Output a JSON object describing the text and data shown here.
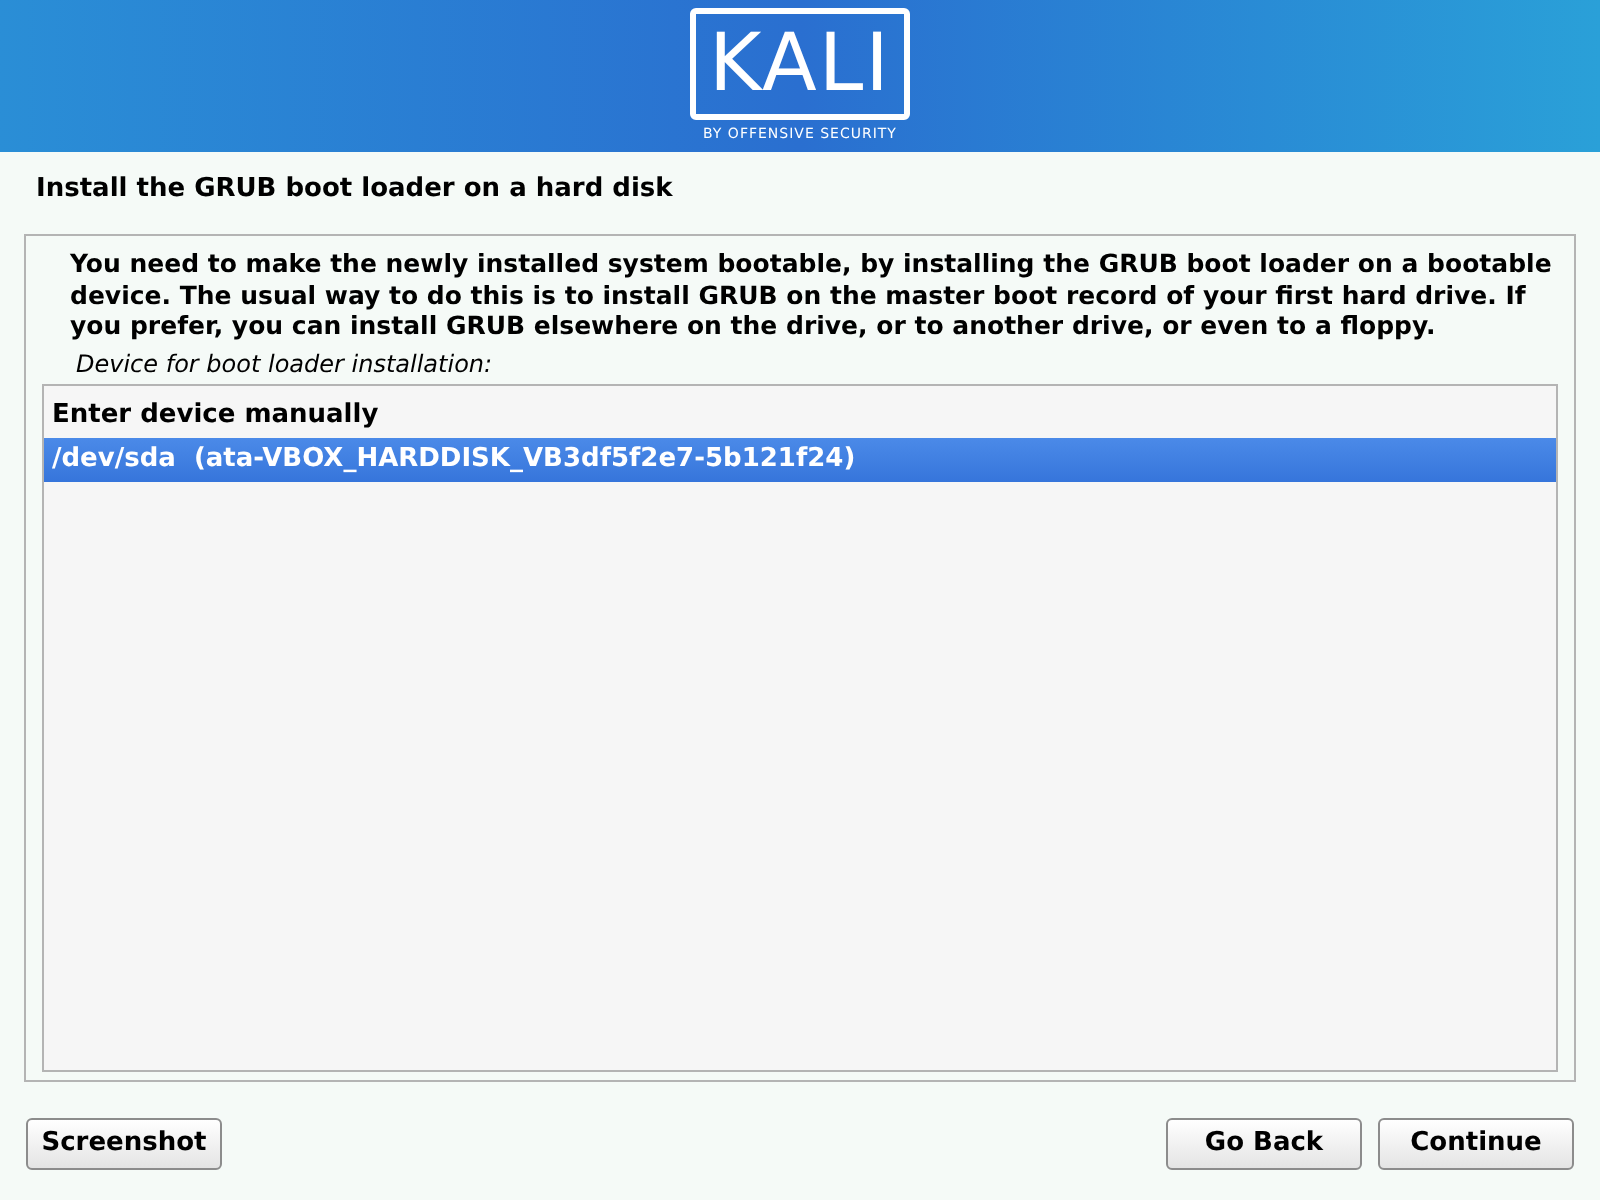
{
  "header": {
    "logo_text": "KALI",
    "logo_subtitle": "BY OFFENSIVE SECURITY"
  },
  "title": "Install the GRUB boot loader on a hard disk",
  "description": "You need to make the newly installed system bootable, by installing the GRUB boot loader on a bootable device. The usual way to do this is to install GRUB on the master boot record of your first hard drive. If you prefer, you can install GRUB elsewhere on the drive, or to another drive, or even to a floppy.",
  "prompt": "Device for boot loader installation:",
  "devices": [
    {
      "label": "Enter device manually",
      "selected": false
    },
    {
      "label": "/dev/sda  (ata-VBOX_HARDDISK_VB3df5f2e7-5b121f24)",
      "selected": true
    }
  ],
  "buttons": {
    "left": [
      "Screenshot"
    ],
    "right": [
      "Go Back",
      "Continue"
    ]
  }
}
